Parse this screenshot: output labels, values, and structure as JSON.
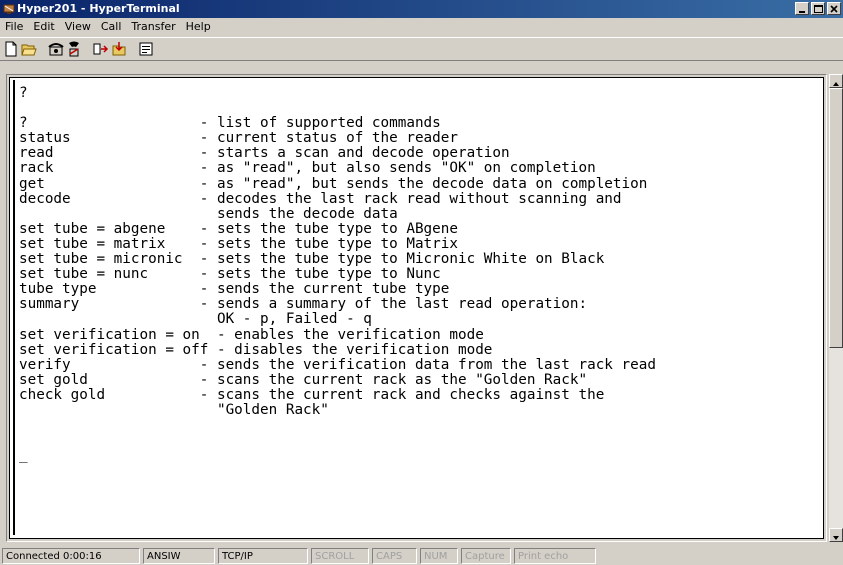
{
  "window": {
    "title": "Hyper201 - HyperTerminal"
  },
  "menu": [
    "File",
    "Edit",
    "View",
    "Call",
    "Transfer",
    "Help"
  ],
  "toolbar": {
    "icons": [
      "new-icon",
      "open-icon",
      "phone-connect-icon",
      "disconnect-icon",
      "send-icon",
      "receive-icon",
      "properties-icon"
    ]
  },
  "terminal": {
    "text": "?\n\n?                    - list of supported commands\nstatus               - current status of the reader\nread                 - starts a scan and decode operation\nrack                 - as \"read\", but also sends \"OK\" on completion\nget                  - as \"read\", but sends the decode data on completion\ndecode               - decodes the last rack read without scanning and\n                       sends the decode data\nset tube = abgene    - sets the tube type to ABgene\nset tube = matrix    - sets the tube type to Matrix\nset tube = micronic  - sets the tube type to Micronic White on Black\nset tube = nunc      - sets the tube type to Nunc\ntube type            - sends the current tube type\nsummary              - sends a summary of the last read operation:\n                       OK - p, Failed - q\nset verification = on  - enables the verification mode\nset verification = off - disables the verification mode\nverify               - sends the verification data from the last rack read\nset gold             - scans the current rack as the \"Golden Rack\"\ncheck gold           - scans the current rack and checks against the\n                       \"Golden Rack\"\n\n\n_"
  },
  "status": {
    "connected": "Connected 0:00:16",
    "emulation": "ANSIW",
    "connection": "TCP/IP",
    "scroll": "SCROLL",
    "caps": "CAPS",
    "num": "NUM",
    "capture": "Capture",
    "print_echo": "Print echo"
  }
}
